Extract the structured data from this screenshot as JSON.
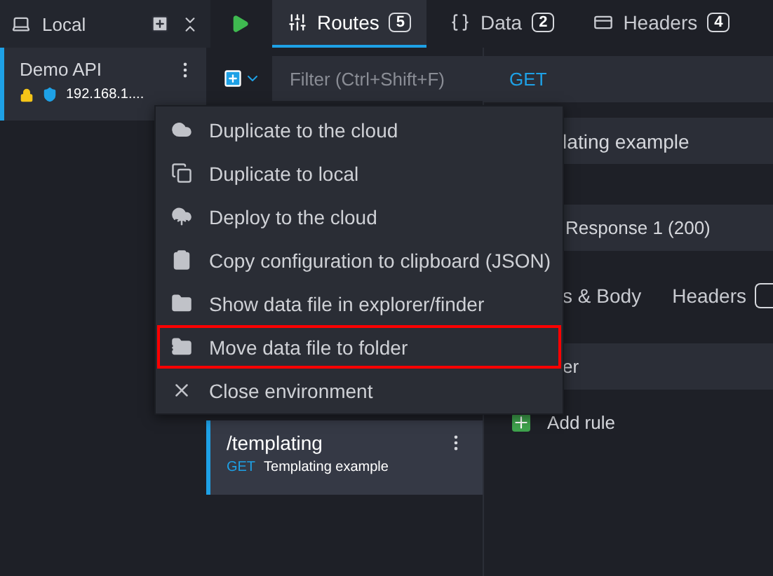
{
  "sidebar": {
    "header": {
      "label": "Local"
    },
    "environments": [
      {
        "name": "Demo API",
        "address": "192.168.1....",
        "selected": true
      }
    ]
  },
  "top_tabs": [
    {
      "label": "Routes",
      "count": "5",
      "selected": true
    },
    {
      "label": "Data",
      "count": "2",
      "selected": false
    },
    {
      "label": "Headers",
      "count": "4",
      "selected": false
    }
  ],
  "routes": {
    "filter": {
      "placeholder": "Filter (Ctrl+Shift+F)"
    },
    "items": [
      {
        "path": "/templating",
        "method": "GET",
        "description": "Templating example",
        "selected": true
      }
    ]
  },
  "main": {
    "method": "GET",
    "documentation": "lating example",
    "response": "Response 1 (200)",
    "tabs": [
      {
        "label": "s & Body",
        "selected": false
      },
      {
        "label": "Headers",
        "selected": false
      }
    ],
    "rules_header": "er",
    "add_rule": "Add rule"
  },
  "context_menu": [
    {
      "label": "Duplicate to the cloud",
      "highlighted": false
    },
    {
      "label": "Duplicate to local",
      "highlighted": false
    },
    {
      "label": "Deploy to the cloud",
      "highlighted": false
    },
    {
      "label": "Copy configuration to clipboard (JSON)",
      "highlighted": false
    },
    {
      "label": "Show data file in explorer/finder",
      "highlighted": false
    },
    {
      "label": "Move data file to folder",
      "highlighted": true
    },
    {
      "label": "Close environment",
      "highlighted": false
    }
  ]
}
